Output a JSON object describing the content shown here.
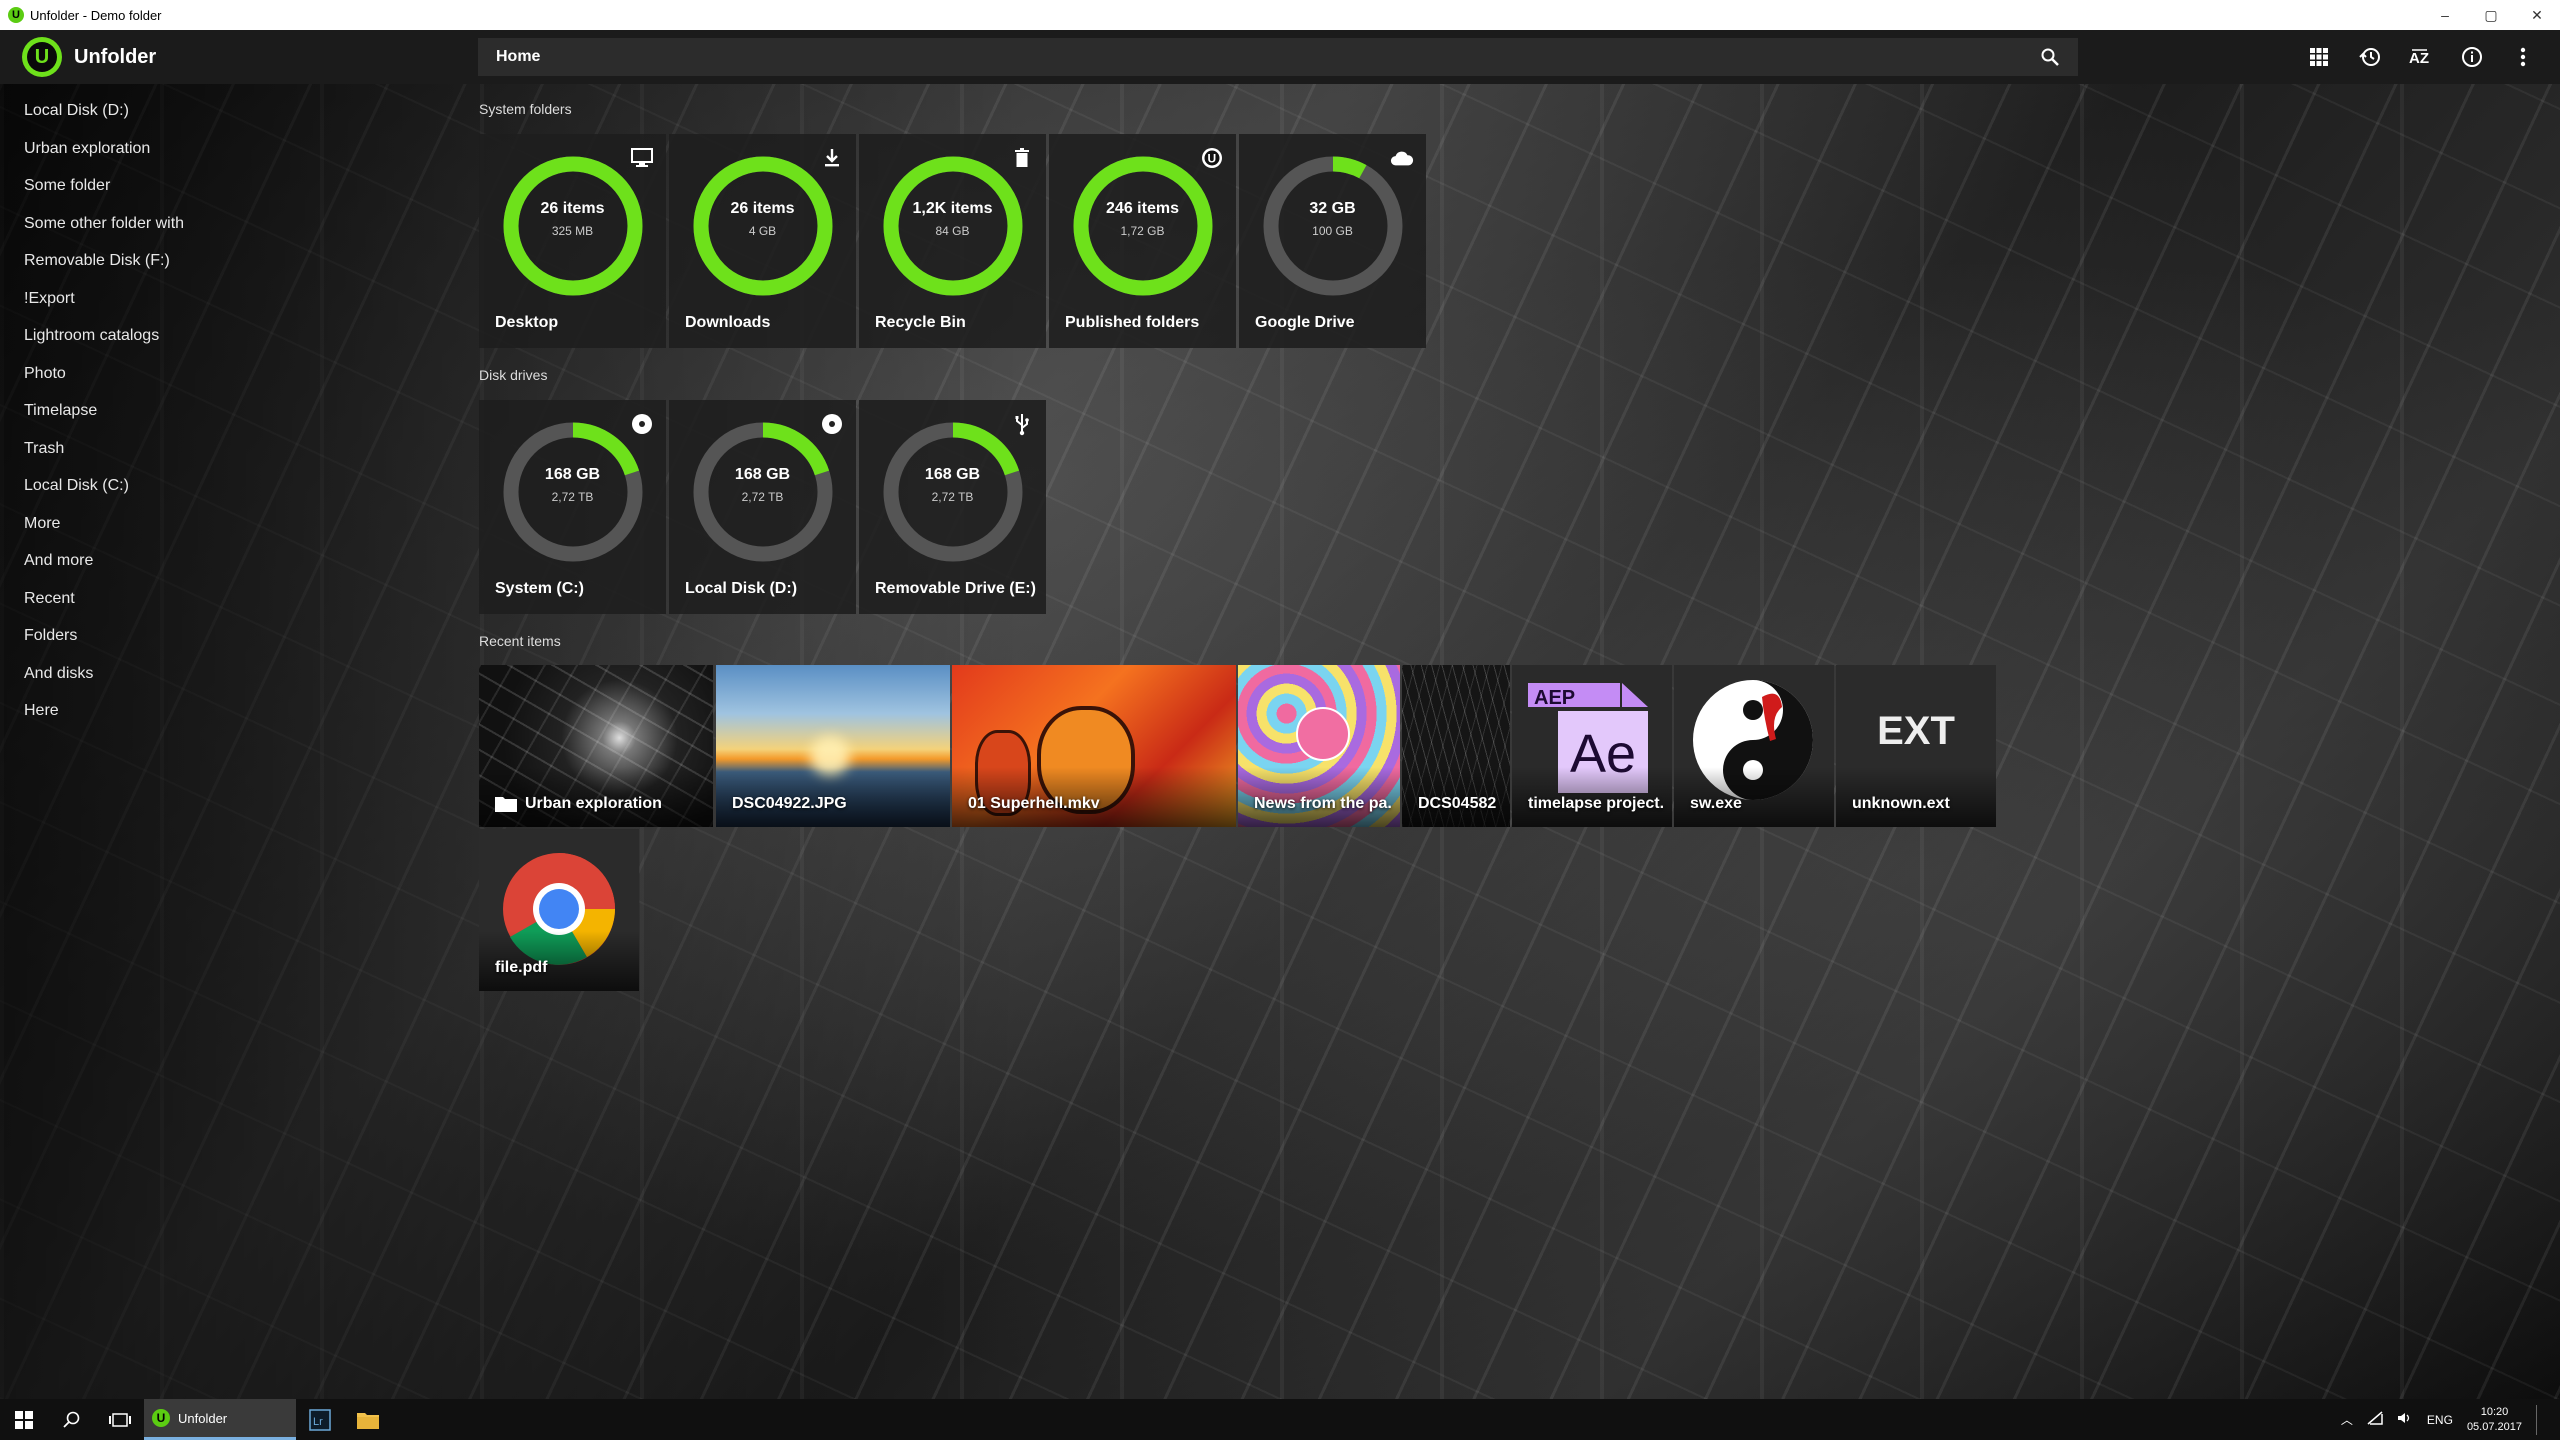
{
  "window": {
    "title": "Unfolder - Demo folder",
    "controls": [
      "–",
      "▢",
      "✕"
    ]
  },
  "app": {
    "name": "Unfolder",
    "logo_letter": "U"
  },
  "pathbar": {
    "path": "Home"
  },
  "sidebar": {
    "items": [
      "Local Disk (D:)",
      "Urban exploration",
      "Some folder",
      "Some other folder with",
      "Removable Disk (F:)",
      "!Export",
      "Lightroom catalogs",
      "Photo",
      "Timelapse",
      "Trash",
      "Local Disk (C:)",
      "More",
      "And more",
      "Recent",
      "Folders",
      "And disks",
      "Here"
    ]
  },
  "sections": {
    "system": "System folders",
    "disks": "Disk drives",
    "recent": "Recent items"
  },
  "system_folders": [
    {
      "name": "Desktop",
      "main": "26 items",
      "sub": "325 MB",
      "fill": 1.0,
      "icon": "monitor-icon"
    },
    {
      "name": "Downloads",
      "main": "26 items",
      "sub": "4 GB",
      "fill": 1.0,
      "icon": "download-icon"
    },
    {
      "name": "Recycle Bin",
      "main": "1,2K items",
      "sub": "84 GB",
      "fill": 1.0,
      "icon": "trash-icon"
    },
    {
      "name": "Published folders",
      "main": "246 items",
      "sub": "1,72 GB",
      "fill": 1.0,
      "icon": "unfolder-icon"
    },
    {
      "name": "Google Drive",
      "main": "32 GB",
      "sub": "100 GB",
      "fill": 0.08,
      "icon": "cloud-icon"
    }
  ],
  "disk_drives": [
    {
      "name": "System (C:)",
      "main": "168 GB",
      "sub": "2,72 TB",
      "fill": 0.2,
      "icon": "disk-icon"
    },
    {
      "name": "Local Disk (D:)",
      "main": "168 GB",
      "sub": "2,72 TB",
      "fill": 0.2,
      "icon": "disk-icon"
    },
    {
      "name": "Removable Drive (E:)",
      "main": "168 GB",
      "sub": "2,72 TB",
      "fill": 0.2,
      "icon": "usb-icon"
    }
  ],
  "recent_items": [
    {
      "label": "Urban exploration",
      "kind": "folder"
    },
    {
      "label": "DSC04922.JPG",
      "kind": "photo"
    },
    {
      "label": "01 Superhell.mkv",
      "kind": "video"
    },
    {
      "label": "News from the pa.",
      "kind": "image"
    },
    {
      "label": "DCS04582",
      "kind": "photo-dark"
    },
    {
      "label": "timelapse project.",
      "kind": "aep",
      "badge": "AEP",
      "glyph": "Ae"
    },
    {
      "label": "sw.exe",
      "kind": "exe"
    },
    {
      "label": "unknown.ext",
      "kind": "ext",
      "glyph": "EXT"
    },
    {
      "label": "file.pdf",
      "kind": "pdf"
    }
  ],
  "taskbar": {
    "active_app": "Unfolder",
    "lang": "ENG",
    "time": "10:20",
    "date": "05.07.2017"
  },
  "colors": {
    "accent": "#6ee11b",
    "ring_track": "#555555",
    "tile_bg": "#1e1e1e"
  }
}
